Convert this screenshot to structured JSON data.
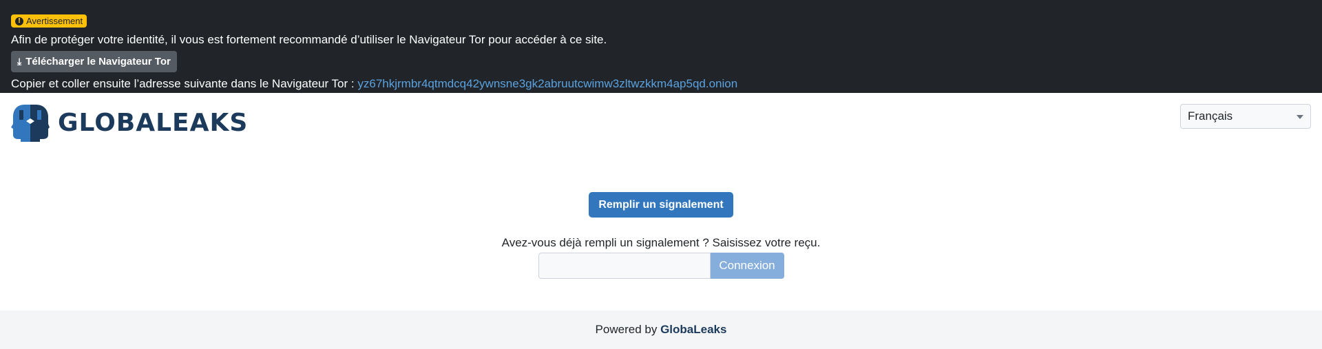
{
  "tor_banner": {
    "badge_label": "Avertissement",
    "badge_icon": "exclamation-circle-icon",
    "message": "Afin de protéger votre identité, il vous est fortement recommandé d’utiliser le Navigateur Tor pour accéder à ce site.",
    "download_button_label": "Télécharger le Navigateur Tor",
    "download_icon": "download-icon",
    "copy_instruction": "Copier et coller ensuite l’adresse suivante dans le Navigateur Tor :",
    "onion_address": "yz67hkjrmbr4qtmdcq42ywnsne3gk2abruutcwimw3zltwzkkm4ap5qd.onion"
  },
  "header": {
    "logo_text": "GLOBALEAKS",
    "language_selected": "Français"
  },
  "main": {
    "submit_button_label": "Remplir un signalement",
    "receipt_question": "Avez-vous déjà rempli un signalement ? Saisissez votre reçu.",
    "receipt_placeholder": "",
    "login_button_label": "Connexion"
  },
  "footer": {
    "powered_by": "Powered by",
    "brand_link": "GlobaLeaks"
  },
  "colors": {
    "banner_bg": "#212529",
    "badge_bg": "#ffc107",
    "primary": "#3277bd",
    "login_disabled": "#86aedc",
    "link": "#5aa2e0",
    "brand": "#1c3a5c",
    "footer_bg": "#f4f5f7"
  }
}
